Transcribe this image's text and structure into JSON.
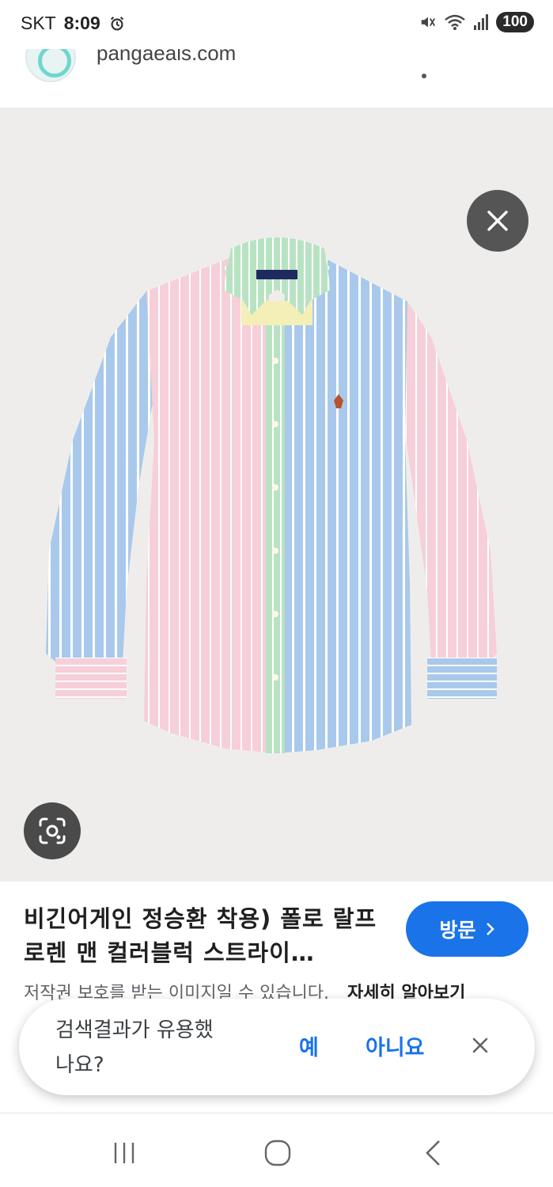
{
  "status_bar": {
    "carrier": "SKT",
    "time": "8:09",
    "battery": "100",
    "icons": [
      "alarm-icon",
      "mute-icon",
      "wifi-icon",
      "signal-icon"
    ]
  },
  "source": {
    "site": "pangaeals.com"
  },
  "result": {
    "title": "비긴어게인 정승환 착용) 폴로 랄프로렌 맨 컬러블럭 스트라이…",
    "visit_label": "방문",
    "copyright": "저작권 보호를 받는 이미지일 수 있습니다.",
    "learn_more": "자세히 알아보기"
  },
  "feedback": {
    "question": "검색결과가 유용했나요?",
    "yes": "예",
    "no": "아니요"
  },
  "colors": {
    "accent": "#1a73e8",
    "image_bg": "#efedec",
    "shirt_blue": "#a9c9ec",
    "shirt_pink": "#f6cfd9",
    "shirt_green": "#b8e3c2"
  }
}
